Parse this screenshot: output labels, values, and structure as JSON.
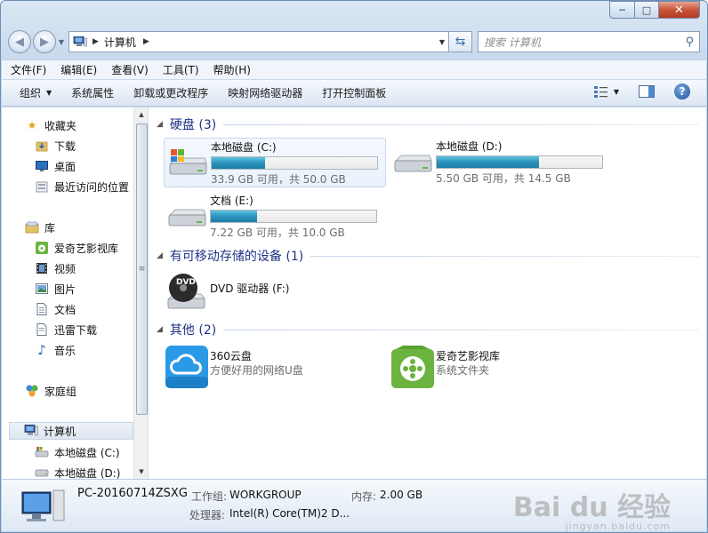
{
  "window": {
    "caption_min": "─",
    "caption_max": "□",
    "caption_close": "✕"
  },
  "address": {
    "crumb": "计算机",
    "search_placeholder": "搜索 计算机"
  },
  "menu": [
    "文件(F)",
    "编辑(E)",
    "查看(V)",
    "工具(T)",
    "帮助(H)"
  ],
  "commands": {
    "organize": "组织",
    "system_properties": "系统属性",
    "uninstall": "卸载或更改程序",
    "map_drive": "映射网络驱动器",
    "control_panel": "打开控制面板"
  },
  "nav": {
    "favorites": "收藏夹",
    "downloads": "下载",
    "desktop": "桌面",
    "recent": "最近访问的位置",
    "libraries": "库",
    "iqiyi": "爱奇艺影视库",
    "videos": "视频",
    "pictures": "图片",
    "documents": "文档",
    "xunlei": "迅雷下载",
    "music": "音乐",
    "homegroup": "家庭组",
    "computer": "计算机",
    "disk_c": "本地磁盘 (C:)",
    "disk_d": "本地磁盘 (D:)"
  },
  "groups": {
    "hdd": "硬盘 (3)",
    "removable": "有可移动存储的设备 (1)",
    "other": "其他 (2)"
  },
  "drives": [
    {
      "name": "本地磁盘 (C:)",
      "used_fraction": 0.32,
      "meta": "33.9 GB 可用，共 50.0 GB"
    },
    {
      "name": "本地磁盘 (D:)",
      "used_fraction": 0.62,
      "meta": "5.50 GB 可用，共 14.5 GB"
    },
    {
      "name": "文档 (E:)",
      "used_fraction": 0.28,
      "meta": "7.22 GB 可用，共 10.0 GB"
    }
  ],
  "removable": {
    "name": "DVD 驱动器 (F:)",
    "dvd_label": "DVD"
  },
  "other": [
    {
      "name": "360云盘",
      "desc": "方便好用的网络U盘"
    },
    {
      "name": "爱奇艺影视库",
      "desc": "系统文件夹"
    }
  ],
  "details": {
    "pc_name": "PC-20160714ZSXG",
    "workgroup_label": "工作组:",
    "workgroup_value": "WORKGROUP",
    "memory_label": "内存:",
    "memory_value": "2.00 GB",
    "cpu_label": "处理器:",
    "cpu_value": "Intel(R) Core(TM)2 D..."
  },
  "watermark": {
    "main": "Bai du 经验",
    "sub": "jingyan.baidu.com"
  },
  "colors": {
    "accent": "#1e3287",
    "bar_fill": "#2b93bd",
    "close_red": "#c8553b"
  }
}
